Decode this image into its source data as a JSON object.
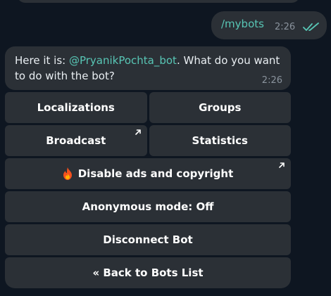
{
  "outgoing": {
    "text": "/mybots",
    "time": "2:26",
    "status_icon": "double-check-icon"
  },
  "incoming": {
    "text_before": "Here it is: ",
    "mention": "@PryanikPochta_bot",
    "text_after": ". What do you want to do with the bot?",
    "time": "2:26"
  },
  "keyboard": {
    "localizations": "Localizations",
    "groups": "Groups",
    "broadcast": "Broadcast",
    "statistics": "Statistics",
    "disable_ads": "Disable ads and copyright",
    "anonymous": "Anonymous mode: Off",
    "disconnect": "Disconnect Bot",
    "back": "« Back to Bots List"
  },
  "colors": {
    "background": "#0e1621",
    "bubble": "#2b3036",
    "mention": "#58c6b5",
    "meta": "#8a939d"
  }
}
